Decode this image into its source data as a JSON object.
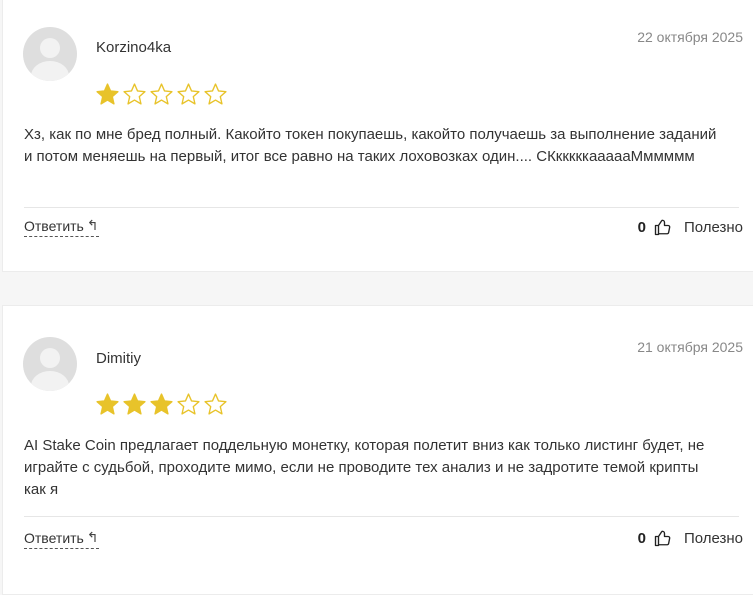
{
  "colors": {
    "star": "#e8c32a",
    "accent_text": "#333333",
    "date": "#888888"
  },
  "reviews": [
    {
      "author": "Korzino4ka",
      "date": "22 октября 2025",
      "rating": 1,
      "max_rating": 5,
      "text": "Хз, как по мне бред полный. Какойто токен покупаешь, какойто получаешь за выполнение заданий и потом меняешь на первый, итог все равно на таких лоховозках один.... СКкккккаааааМммммм",
      "reply_label": "Ответить",
      "likes": "0",
      "useful_label": "Полезно"
    },
    {
      "author": "Dimitiy",
      "date": "21 октября 2025",
      "rating": 3,
      "max_rating": 5,
      "text": "AI Stake Coin предлагает поддельную монетку, которая полетит вниз как только листинг будет, не играйте с судьбой, проходите мимо, если не проводите тех анализ и не задротите темой крипты как я",
      "reply_label": "Ответить",
      "likes": "0",
      "useful_label": "Полезно"
    }
  ]
}
